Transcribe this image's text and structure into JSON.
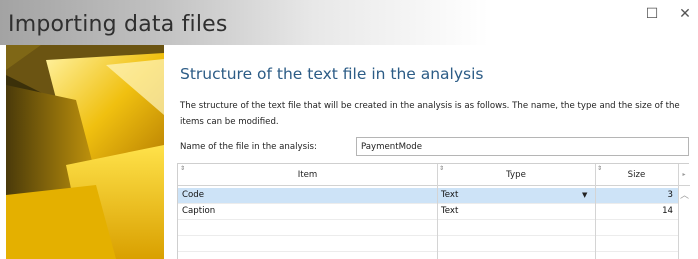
{
  "window": {
    "title": "Importing data files",
    "maximize_glyph": "☐",
    "close_glyph": "✕"
  },
  "section": {
    "heading": "Structure of the text file in the analysis",
    "description": "The structure of the text file that will be created in the analysis is as follows. The name, the type and the size of the items can be modified."
  },
  "file_name": {
    "label": "Name of the file in the analysis:",
    "value": "PaymentMode"
  },
  "table": {
    "columns": [
      "Item",
      "Type",
      "Size"
    ],
    "sort_glyph": "⇕",
    "dropdown_glyph": "▼",
    "rows": [
      {
        "item": "Code",
        "type": "Text",
        "size": "3"
      },
      {
        "item": "Caption",
        "type": "Text",
        "size": "14"
      }
    ],
    "scroll_up_glyph": "︿",
    "header_arrow_glyph": "▸"
  },
  "colors": {
    "heading": "#2c5c86",
    "selected_row": "#cde3f7",
    "title_text": "#2f2f2f"
  },
  "icons": [
    "maximize-icon",
    "close-icon",
    "sort-icon",
    "dropdown-arrow-icon",
    "scroll-up-icon"
  ]
}
